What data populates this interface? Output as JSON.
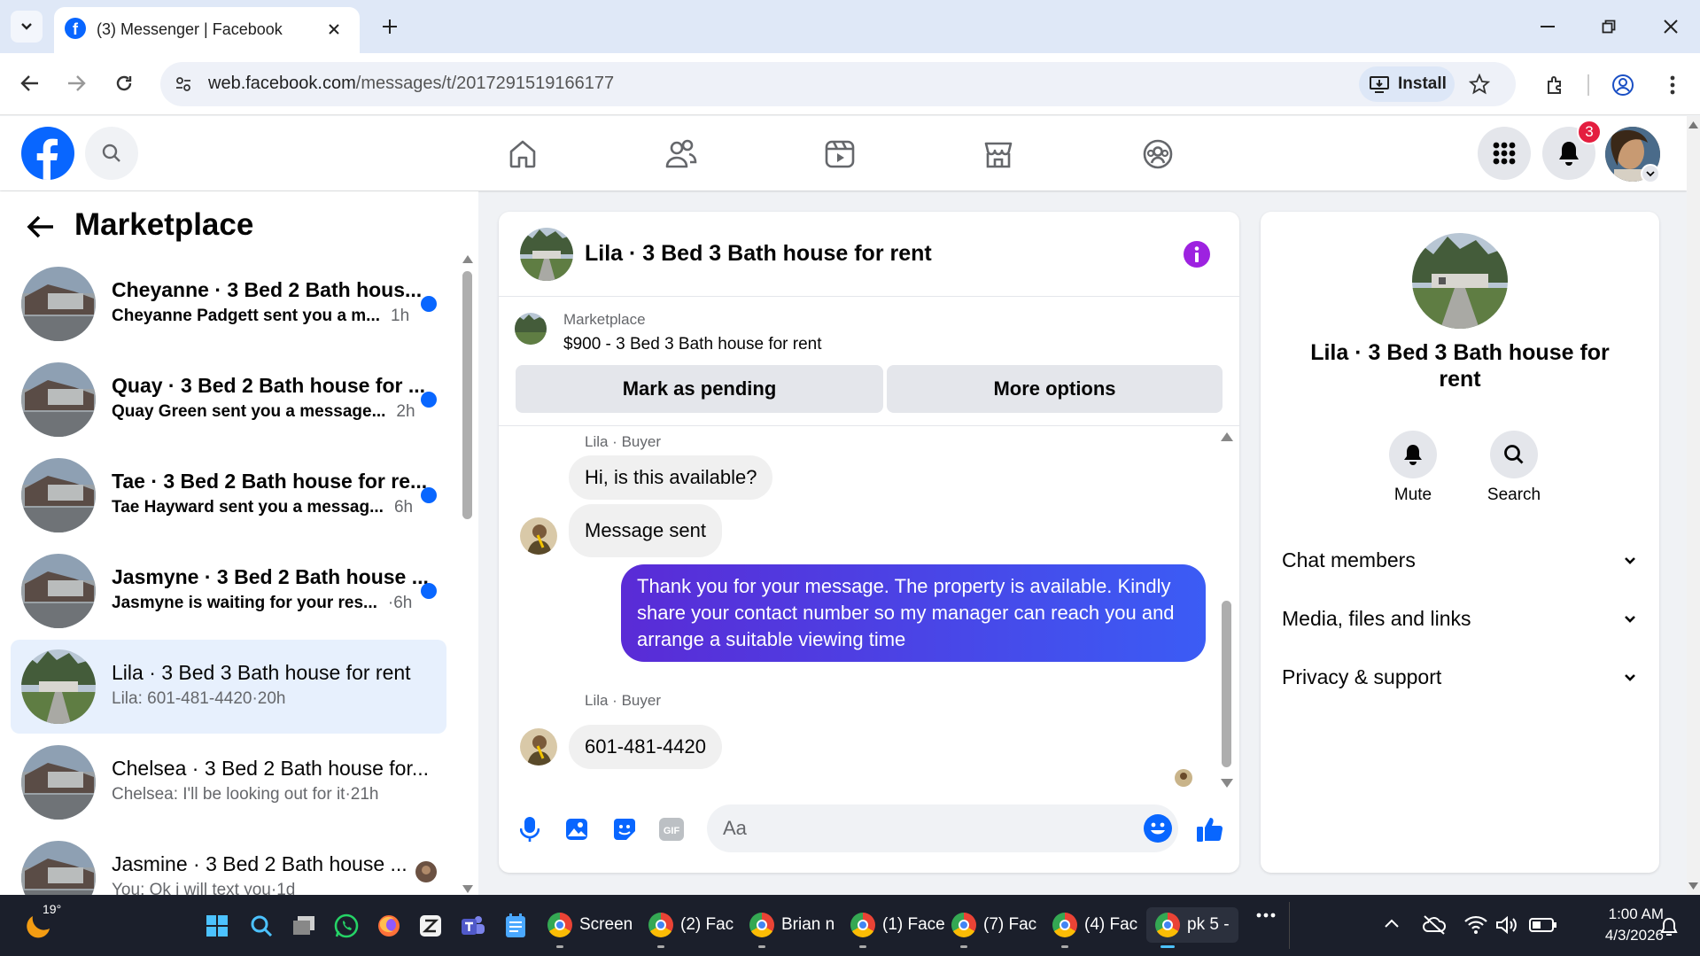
{
  "browser": {
    "tab_title": "(3) Messenger | Facebook",
    "url_host": "web.facebook.com",
    "url_path": "/messages/t/2017291519166177",
    "install_label": "Install"
  },
  "fb_header": {
    "notification_count": "3",
    "nav_icons": [
      "home-icon",
      "friends-icon",
      "video-icon",
      "marketplace-icon",
      "groups-icon"
    ]
  },
  "left_panel": {
    "title": "Marketplace",
    "conversations": [
      {
        "title": "Cheyanne · 3 Bed 2 Bath hous...",
        "preview": "Cheyanne Padgett sent you a m...",
        "time": "1h",
        "unread": true
      },
      {
        "title": "Quay · 3 Bed 2 Bath house for ...",
        "preview": "Quay Green sent you a message...",
        "time": "2h",
        "unread": true
      },
      {
        "title": "Tae · 3 Bed 2 Bath house for re...",
        "preview": "Tae Hayward sent you a messag...",
        "time": "6h",
        "unread": true
      },
      {
        "title": "Jasmyne · 3 Bed 2 Bath house ...",
        "preview": "Jasmyne is waiting for your res...",
        "time": "·6h",
        "unread": true
      },
      {
        "title": "Lila · 3 Bed 3 Bath house for rent",
        "preview": "Lila: 601-481-4420",
        "time": "·20h",
        "unread": false
      },
      {
        "title": "Chelsea · 3 Bed 2 Bath house for...",
        "preview": "Chelsea: I'll be looking out for it",
        "time": "·21h",
        "unread": false
      },
      {
        "title": "Jasmine · 3 Bed 2 Bath house ...",
        "preview": "You: Ok i will text you",
        "time": "·1d",
        "unread": false
      }
    ]
  },
  "chat": {
    "header_title": "Lila · 3 Bed 3 Bath house for rent",
    "listing": {
      "label": "Marketplace",
      "title": "$900 - 3 Bed 3 Bath house for rent",
      "btn_pending": "Mark as pending",
      "btn_more": "More options"
    },
    "messages": {
      "sender1": "Lila · Buyer",
      "m1": "Hi, is this available?",
      "m2": "Message sent",
      "m3_lines": [
        "Thank you for your message. The property is available. Kindly",
        "share your contact number so my manager can reach you and",
        "arrange a suitable viewing time"
      ],
      "sender2": "Lila · Buyer",
      "m4": "601-481-4420"
    },
    "composer": {
      "placeholder": "Aa"
    }
  },
  "right_panel": {
    "title_lines": [
      "Lila · 3 Bed 3 Bath house for",
      "rent"
    ],
    "mute_label": "Mute",
    "search_label": "Search",
    "sections": [
      "Chat members",
      "Media, files and links",
      "Privacy & support"
    ]
  },
  "taskbar": {
    "weather": "19°",
    "apps": [
      "Screen",
      "(2) Fac",
      "Brian n",
      "(1) Face",
      "(7) Fac",
      "(4) Fac",
      "pk 5 -"
    ],
    "time": "1:00 AM",
    "date": "4/3/2026"
  },
  "colors": {
    "fb_blue": "#0866ff",
    "accent_purple": "#8a2be2",
    "bubble_gradient": [
      "#5a2bd6",
      "#3b5cf5"
    ]
  }
}
